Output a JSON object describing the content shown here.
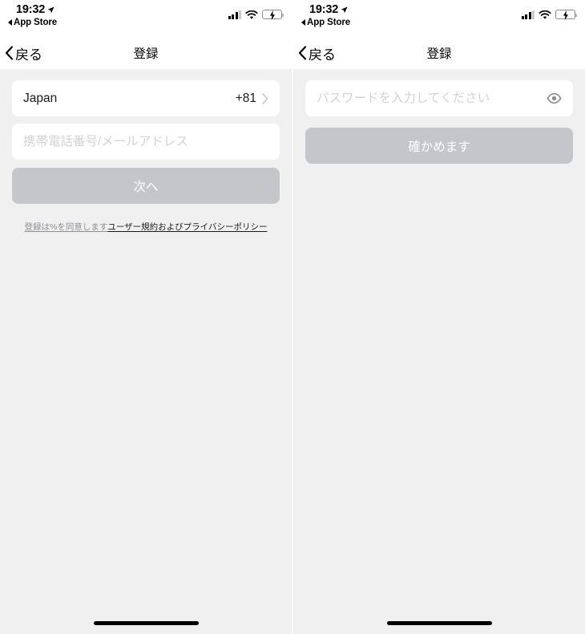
{
  "status_bar": {
    "time": "19:32",
    "back_app_label": "App Store",
    "location_icon": "location-arrow-icon",
    "signal_icon": "cellular-signal-icon",
    "wifi_icon": "wifi-icon",
    "battery_icon": "battery-charging-low-icon",
    "battery_color": "#f03b2e"
  },
  "nav": {
    "back_label": "戻る",
    "back_icon": "chevron-left-icon",
    "title": "登録"
  },
  "screen_left": {
    "country_row": {
      "name": "Japan",
      "dial_code": "+81",
      "chevron_icon": "chevron-right-icon"
    },
    "account_input": {
      "value": "",
      "placeholder": "携帯電話番号/メールアドレス"
    },
    "submit_label": "次へ",
    "terms": {
      "prefix": "登録は%を同意します",
      "link": "ユーザー規約およびプライバシーポリシー"
    }
  },
  "screen_right": {
    "password_input": {
      "value": "",
      "placeholder": "パスワードを入力してください",
      "reveal_icon": "eye-icon"
    },
    "submit_label": "確かめます"
  },
  "colors": {
    "page_background": "#f0f0f0",
    "card_background": "#ffffff",
    "disabled_button": "#c5c6ca",
    "placeholder_text": "#d3d3d6",
    "muted_text": "#8e8e93"
  }
}
